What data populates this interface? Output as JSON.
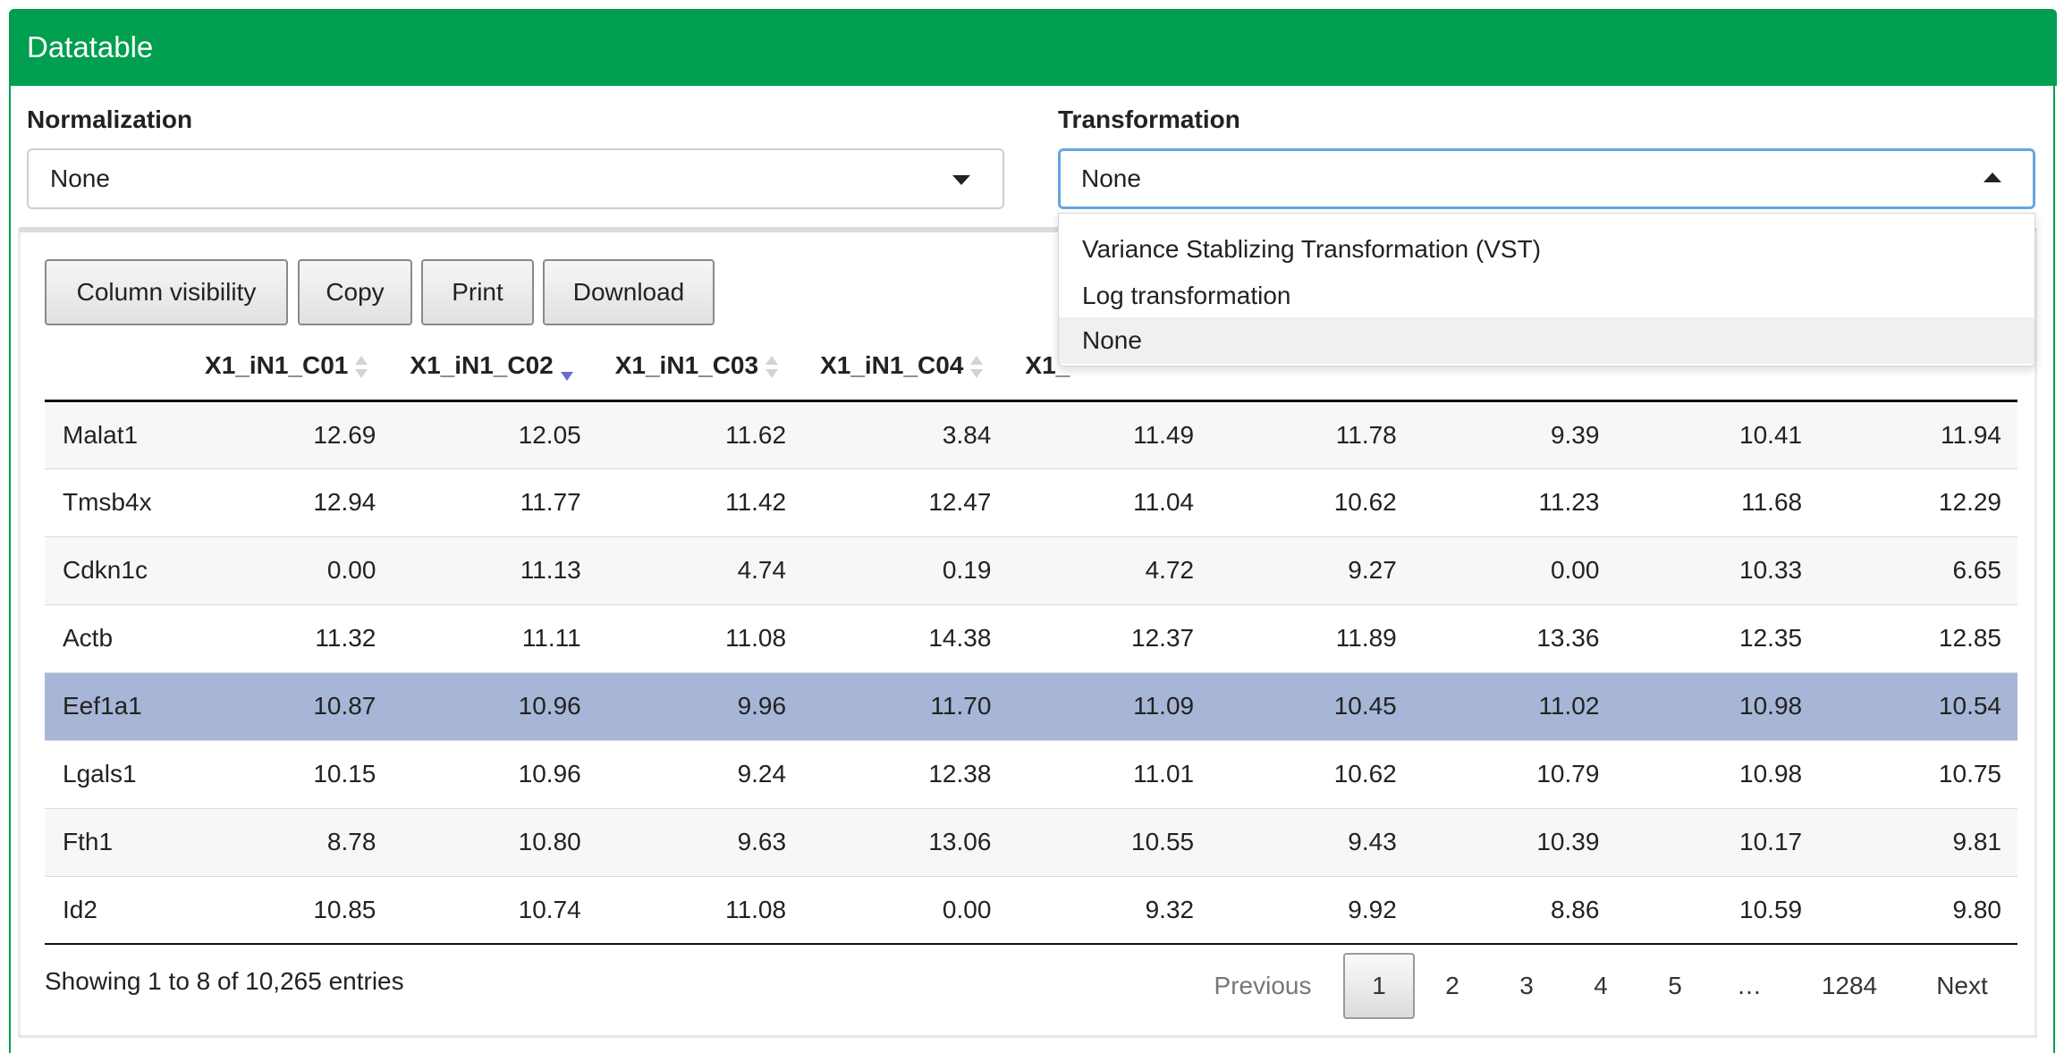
{
  "panel": {
    "title": "Datatable",
    "accent": "#009e4f"
  },
  "normalization": {
    "label": "Normalization",
    "value": "None"
  },
  "transformation": {
    "label": "Transformation",
    "value": "None",
    "options": [
      "Variance Stablizing Transformation (VST)",
      "Log transformation",
      "None"
    ],
    "highlighted": "None"
  },
  "buttons": {
    "column_visibility": "Column visibility",
    "copy": "Copy",
    "print": "Print",
    "download": "Download"
  },
  "table": {
    "headers": [
      "",
      "X1_iN1_C01",
      "X1_iN1_C02",
      "X1_iN1_C03",
      "X1_iN1_C04",
      "X1_",
      "",
      "",
      "",
      ""
    ],
    "sorted_column": "X1_iN1_C02",
    "sort_direction": "descending",
    "rows": [
      {
        "name": "Malat1",
        "values": [
          "12.69",
          "12.05",
          "11.62",
          "3.84",
          "11.49",
          "11.78",
          "9.39",
          "10.41",
          "11.94"
        ]
      },
      {
        "name": "Tmsb4x",
        "values": [
          "12.94",
          "11.77",
          "11.42",
          "12.47",
          "11.04",
          "10.62",
          "11.23",
          "11.68",
          "12.29"
        ]
      },
      {
        "name": "Cdkn1c",
        "values": [
          "0.00",
          "11.13",
          "4.74",
          "0.19",
          "4.72",
          "9.27",
          "0.00",
          "10.33",
          "6.65"
        ]
      },
      {
        "name": "Actb",
        "values": [
          "11.32",
          "11.11",
          "11.08",
          "14.38",
          "12.37",
          "11.89",
          "13.36",
          "12.35",
          "12.85"
        ]
      },
      {
        "name": "Eef1a1",
        "values": [
          "10.87",
          "10.96",
          "9.96",
          "11.70",
          "11.09",
          "10.45",
          "11.02",
          "10.98",
          "10.54"
        ]
      },
      {
        "name": "Lgals1",
        "values": [
          "10.15",
          "10.96",
          "9.24",
          "12.38",
          "11.01",
          "10.62",
          "10.79",
          "10.98",
          "10.75"
        ]
      },
      {
        "name": "Fth1",
        "values": [
          "8.78",
          "10.80",
          "9.63",
          "13.06",
          "10.55",
          "9.43",
          "10.39",
          "10.17",
          "9.81"
        ]
      },
      {
        "name": "Id2",
        "values": [
          "10.85",
          "10.74",
          "11.08",
          "0.00",
          "9.32",
          "9.92",
          "8.86",
          "10.59",
          "9.80"
        ]
      }
    ],
    "selected_row": "Eef1a1",
    "selected_color": "#a7b6d6"
  },
  "footer": {
    "info": "Showing 1 to 8 of 10,265 entries",
    "previous": "Previous",
    "pages": [
      "1",
      "2",
      "3",
      "4",
      "5",
      "…",
      "1284"
    ],
    "current_page": "1",
    "next": "Next"
  }
}
